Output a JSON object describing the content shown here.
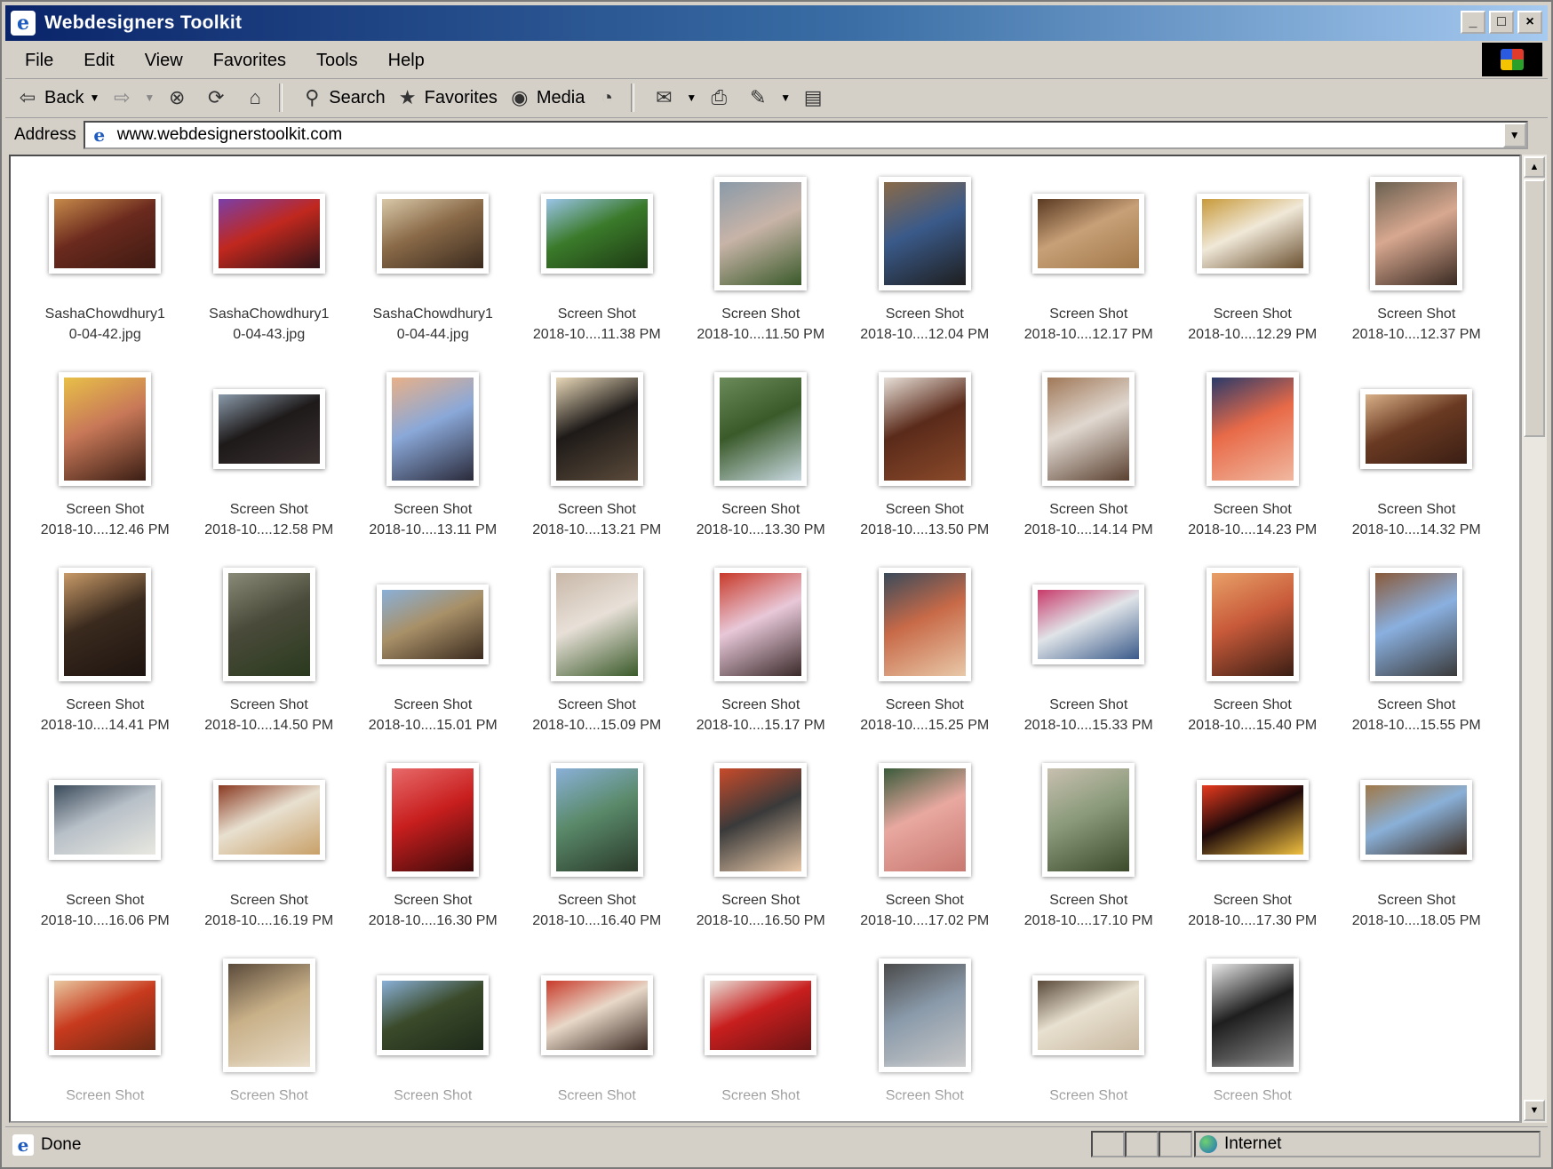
{
  "window": {
    "title": "Webdesigners Toolkit",
    "minimize": "_",
    "maximize": "□",
    "close": "×"
  },
  "menu": [
    {
      "label": "File"
    },
    {
      "label": "Edit"
    },
    {
      "label": "View"
    },
    {
      "label": "Favorites"
    },
    {
      "label": "Tools"
    },
    {
      "label": "Help"
    }
  ],
  "toolbar": {
    "back": "Back",
    "search": "Search",
    "favorites": "Favorites",
    "media": "Media"
  },
  "address": {
    "label": "Address",
    "url": "www.webdesignerstoolkit.com"
  },
  "files": [
    {
      "l1": "SashaChowdhury1",
      "l2": "0-04-42.jpg",
      "o": "land",
      "c": [
        "#6b2a1e",
        "#c68a4a",
        "#3e1a12"
      ]
    },
    {
      "l1": "SashaChowdhury1",
      "l2": "0-04-43.jpg",
      "o": "land",
      "c": [
        "#c0281e",
        "#7a3fa8",
        "#301418"
      ]
    },
    {
      "l1": "SashaChowdhury1",
      "l2": "0-04-44.jpg",
      "o": "land",
      "c": [
        "#8a6a48",
        "#d8c8a8",
        "#3a2a1e"
      ]
    },
    {
      "l1": "Screen Shot",
      "l2": "2018-10....11.38 PM",
      "o": "land",
      "c": [
        "#3a7a2a",
        "#9ac4e8",
        "#1e3a14"
      ]
    },
    {
      "l1": "Screen Shot",
      "l2": "2018-10....11.50 PM",
      "o": "port",
      "c": [
        "#c8b4a8",
        "#8a9aa8",
        "#3a5a2a"
      ]
    },
    {
      "l1": "Screen Shot",
      "l2": "2018-10....12.04 PM",
      "o": "port",
      "c": [
        "#3a5a8a",
        "#8a6a48",
        "#1e1e1e"
      ]
    },
    {
      "l1": "Screen Shot",
      "l2": "2018-10....12.17 PM",
      "o": "land",
      "c": [
        "#c8a078",
        "#5a3a22",
        "#a07848"
      ]
    },
    {
      "l1": "Screen Shot",
      "l2": "2018-10....12.29 PM",
      "o": "land",
      "c": [
        "#f0e8d8",
        "#c89a3a",
        "#6a5030"
      ]
    },
    {
      "l1": "Screen Shot",
      "l2": "2018-10....12.37 PM",
      "o": "port",
      "c": [
        "#d8a890",
        "#6a6050",
        "#3a2a22"
      ]
    },
    {
      "l1": "Screen Shot",
      "l2": "2018-10....12.46 PM",
      "o": "port",
      "c": [
        "#c87858",
        "#e8c048",
        "#3a1e14"
      ]
    },
    {
      "l1": "Screen Shot",
      "l2": "2018-10....12.58 PM",
      "o": "land",
      "c": [
        "#1e1a1a",
        "#8a9aaa",
        "#3a3030"
      ]
    },
    {
      "l1": "Screen Shot",
      "l2": "2018-10....13.11 PM",
      "o": "port",
      "c": [
        "#8aa8d8",
        "#e8b088",
        "#2a2a3a"
      ]
    },
    {
      "l1": "Screen Shot",
      "l2": "2018-10....13.21 PM",
      "o": "port",
      "c": [
        "#1e1a18",
        "#e8d8b8",
        "#5a4a3a"
      ]
    },
    {
      "l1": "Screen Shot",
      "l2": "2018-10....13.30 PM",
      "o": "port",
      "c": [
        "#3a5a2a",
        "#6a8a5a",
        "#c8d8e0"
      ]
    },
    {
      "l1": "Screen Shot",
      "l2": "2018-10....13.50 PM",
      "o": "port",
      "c": [
        "#5a2a1a",
        "#e8e0d8",
        "#8a4a2a"
      ]
    },
    {
      "l1": "Screen Shot",
      "l2": "2018-10....14.14 PM",
      "o": "port",
      "c": [
        "#e0d8d0",
        "#a07858",
        "#5a4030"
      ]
    },
    {
      "l1": "Screen Shot",
      "l2": "2018-10....14.23 PM",
      "o": "port",
      "c": [
        "#e86a48",
        "#2a3a6a",
        "#f0b8a0"
      ]
    },
    {
      "l1": "Screen Shot",
      "l2": "2018-10....14.32 PM",
      "o": "land",
      "c": [
        "#6a3a22",
        "#d8b088",
        "#3a1e14"
      ]
    },
    {
      "l1": "Screen Shot",
      "l2": "2018-10....14.41 PM",
      "o": "port",
      "c": [
        "#3a2a1e",
        "#c89a68",
        "#1e1410"
      ]
    },
    {
      "l1": "Screen Shot",
      "l2": "2018-10....14.50 PM",
      "o": "port",
      "c": [
        "#4a4a3a",
        "#8a8a78",
        "#2a3a1e"
      ]
    },
    {
      "l1": "Screen Shot",
      "l2": "2018-10....15.01 PM",
      "o": "land",
      "c": [
        "#a89068",
        "#8ab0d8",
        "#3a2a1e"
      ]
    },
    {
      "l1": "Screen Shot",
      "l2": "2018-10....15.09 PM",
      "o": "port",
      "c": [
        "#e8e0d8",
        "#c8b8a8",
        "#3a5a2a"
      ]
    },
    {
      "l1": "Screen Shot",
      "l2": "2018-10....15.17 PM",
      "o": "port",
      "c": [
        "#e8c8d8",
        "#c83a2a",
        "#3a2a2a"
      ]
    },
    {
      "l1": "Screen Shot",
      "l2": "2018-10....15.25 PM",
      "o": "port",
      "c": [
        "#c86a48",
        "#3a4a5a",
        "#e8c8a8"
      ]
    },
    {
      "l1": "Screen Shot",
      "l2": "2018-10....15.33 PM",
      "o": "land",
      "c": [
        "#e0e4e8",
        "#c83a6a",
        "#3a5a8a"
      ]
    },
    {
      "l1": "Screen Shot",
      "l2": "2018-10....15.40 PM",
      "o": "port",
      "c": [
        "#c85a3a",
        "#e8a068",
        "#3a1e14"
      ]
    },
    {
      "l1": "Screen Shot",
      "l2": "2018-10....15.55 PM",
      "o": "port",
      "c": [
        "#8ab0e0",
        "#8a5a3a",
        "#3a3a3a"
      ]
    },
    {
      "l1": "Screen Shot",
      "l2": "2018-10....16.06 PM",
      "o": "land",
      "c": [
        "#b8c0c8",
        "#3a4a5a",
        "#e8e8e0"
      ]
    },
    {
      "l1": "Screen Shot",
      "l2": "2018-10....16.19 PM",
      "o": "land",
      "c": [
        "#e8e0d0",
        "#8a3a22",
        "#c8a068"
      ]
    },
    {
      "l1": "Screen Shot",
      "l2": "2018-10....16.30 PM",
      "o": "port",
      "c": [
        "#c81e1e",
        "#e86a6a",
        "#3a0a0a"
      ]
    },
    {
      "l1": "Screen Shot",
      "l2": "2018-10....16.40 PM",
      "o": "port",
      "c": [
        "#5a8a6a",
        "#8ab0d8",
        "#2a3a2a"
      ]
    },
    {
      "l1": "Screen Shot",
      "l2": "2018-10....16.50 PM",
      "o": "port",
      "c": [
        "#3a3a3a",
        "#c84a2a",
        "#e8c8a8"
      ]
    },
    {
      "l1": "Screen Shot",
      "l2": "2018-10....17.02 PM",
      "o": "port",
      "c": [
        "#e8a8a0",
        "#3a5a3a",
        "#c87870"
      ]
    },
    {
      "l1": "Screen Shot",
      "l2": "2018-10....17.10 PM",
      "o": "port",
      "c": [
        "#8a9a7a",
        "#c8c0b0",
        "#3a4a2a"
      ]
    },
    {
      "l1": "Screen Shot",
      "l2": "2018-10....17.30 PM",
      "o": "land",
      "c": [
        "#1e0a0a",
        "#e83a1e",
        "#f0c040"
      ]
    },
    {
      "l1": "Screen Shot",
      "l2": "2018-10....18.05 PM",
      "o": "land",
      "c": [
        "#8ab0d8",
        "#a07848",
        "#3a2a1e"
      ]
    },
    {
      "l1": "Screen Shot",
      "l2": "",
      "o": "land",
      "c": [
        "#c83a1e",
        "#e8c8a0",
        "#6a2a14"
      ]
    },
    {
      "l1": "Screen Shot",
      "l2": "",
      "o": "port",
      "c": [
        "#c8b088",
        "#5a4a3a",
        "#e8dcc8"
      ]
    },
    {
      "l1": "Screen Shot",
      "l2": "",
      "o": "land",
      "c": [
        "#3a4a2a",
        "#8ab0d8",
        "#1e2a1a"
      ]
    },
    {
      "l1": "Screen Shot",
      "l2": "",
      "o": "land",
      "c": [
        "#e8d8c8",
        "#c83a2a",
        "#3a2a22"
      ]
    },
    {
      "l1": "Screen Shot",
      "l2": "",
      "o": "land",
      "c": [
        "#c81e1e",
        "#e8e0d8",
        "#6a1414"
      ]
    },
    {
      "l1": "Screen Shot",
      "l2": "",
      "o": "port",
      "c": [
        "#8a9aaa",
        "#4a4a4a",
        "#c8c8c8"
      ]
    },
    {
      "l1": "Screen Shot",
      "l2": "",
      "o": "land",
      "c": [
        "#e8e0d0",
        "#5a4a3a",
        "#c8b8a0"
      ]
    },
    {
      "l1": "Screen Shot",
      "l2": "",
      "o": "port",
      "c": [
        "#1e1e1e",
        "#e8e8e8",
        "#8a8a8a"
      ]
    }
  ],
  "status": {
    "text": "Done",
    "zone": "Internet"
  }
}
